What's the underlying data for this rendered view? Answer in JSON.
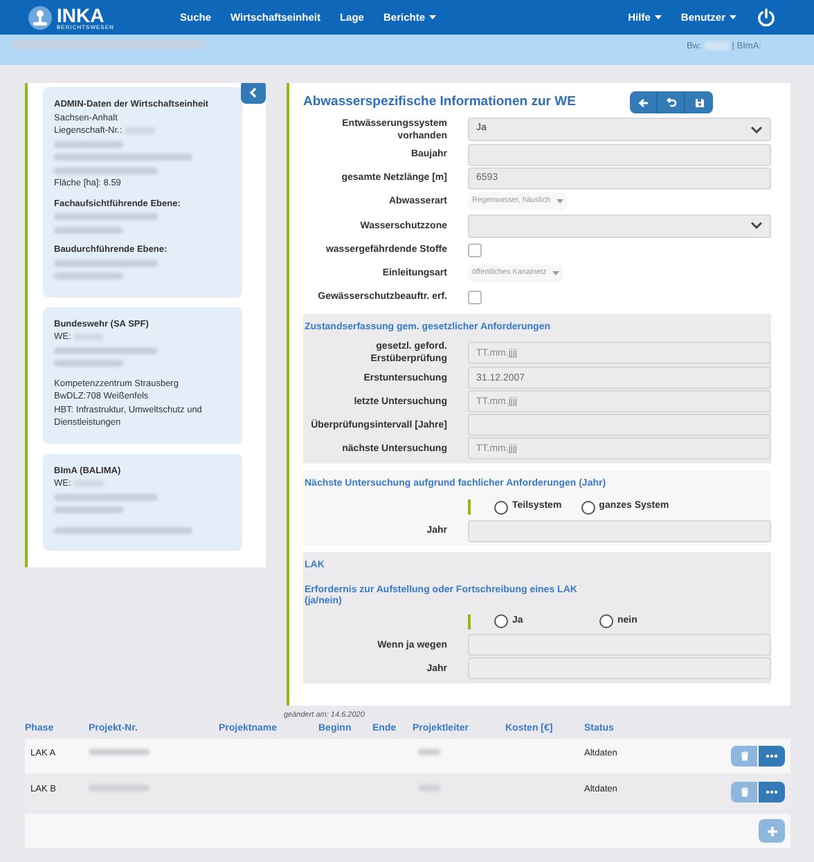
{
  "header": {
    "logo": {
      "name": "INKA",
      "subtitle": "BERICHTSWESEN"
    },
    "nav": [
      {
        "label": "Suche",
        "dropdown": false
      },
      {
        "label": "Wirtschaftseinheit",
        "dropdown": false
      },
      {
        "label": "Lage",
        "dropdown": false
      },
      {
        "label": "Berichte",
        "dropdown": true
      }
    ],
    "right_nav": [
      {
        "label": "Hilfe",
        "dropdown": true
      },
      {
        "label": "Benutzer",
        "dropdown": true
      }
    ]
  },
  "subbar": {
    "bw_label": "Bw:",
    "bima_label": "| BImA:"
  },
  "sidebar": {
    "cards": [
      {
        "title": "ADMIN-Daten der Wirtschaftseinheit",
        "groups": [
          {
            "lines": [
              {
                "kind": "text",
                "text": "Sachsen-Anhalt"
              },
              {
                "kind": "text_redacted",
                "text": "Liegenschaft-Nr.:"
              },
              {
                "kind": "redacted"
              },
              {
                "kind": "redacted"
              },
              {
                "kind": "redacted"
              },
              {
                "kind": "text",
                "text": "Fläche [ha]: 8.59"
              }
            ]
          },
          {
            "lines": [
              {
                "kind": "heading",
                "text": "Fachaufsichtführende Ebene:"
              },
              {
                "kind": "redacted"
              },
              {
                "kind": "redacted"
              }
            ]
          },
          {
            "lines": [
              {
                "kind": "heading",
                "text": "Baudurchführende Ebene:"
              },
              {
                "kind": "redacted"
              },
              {
                "kind": "redacted"
              }
            ]
          }
        ]
      },
      {
        "title": "Bundeswehr (SA SPF)",
        "groups": [
          {
            "lines": [
              {
                "kind": "text_redacted",
                "text": "WE:"
              },
              {
                "kind": "redacted"
              },
              {
                "kind": "redacted"
              }
            ]
          },
          {
            "lines": [
              {
                "kind": "text",
                "text": "Kompetenzzentrum Strausberg"
              },
              {
                "kind": "text",
                "text": "BwDLZ:708 Weißenfels"
              },
              {
                "kind": "text",
                "text": "HBT: Infrastruktur, Umweltschutz und Dienstleistungen"
              }
            ]
          }
        ]
      },
      {
        "title": "BImA (BALIMA)",
        "groups": [
          {
            "lines": [
              {
                "kind": "text_redacted",
                "text": "WE:"
              },
              {
                "kind": "redacted"
              },
              {
                "kind": "redacted"
              }
            ]
          },
          {
            "lines": [
              {
                "kind": "redacted"
              }
            ]
          }
        ]
      }
    ]
  },
  "main": {
    "title": "Abwasserspezifische Informationen zur WE",
    "fields": [
      {
        "label": "Entwässerungssystem vorhanden",
        "kind": "select",
        "value": "Ja"
      },
      {
        "label": "Baujahr",
        "kind": "input"
      },
      {
        "label": "gesamte Netzlänge [m]",
        "kind": "input",
        "value": "6593"
      },
      {
        "label": "Abwasserart",
        "kind": "multiselect",
        "value": "Regenwasser, häuslich"
      },
      {
        "label": "Wasserschutzzone",
        "kind": "select"
      },
      {
        "label": "wassergefährdende Stoffe",
        "kind": "checkbox",
        "checked": false
      },
      {
        "label": "Einleitungsart",
        "kind": "multiselect",
        "value": "öffentliches Kanalnetz"
      },
      {
        "label": "Gewässerschutzbeauftr. erf.",
        "kind": "checkbox",
        "checked": false
      }
    ],
    "sections": [
      {
        "title": "Zustandserfassung gem. gesetzlicher Anforderungen",
        "shaded": true,
        "fields": [
          {
            "label": "gesetzl. geford. Erstüberprüfung",
            "kind": "input",
            "placeholder": "TT.mm.jjjj"
          },
          {
            "label": "Erstuntersuchung",
            "kind": "input",
            "value": "31.12.2007"
          },
          {
            "label": "letzte Untersuchung",
            "kind": "input",
            "placeholder": "TT.mm.jjjj"
          },
          {
            "label": "Überprüfungsintervall [Jahre]",
            "kind": "input"
          },
          {
            "label": "nächste Untersuchung",
            "kind": "input",
            "placeholder": "TT.mm.jjjj"
          }
        ]
      },
      {
        "title": "Nächste Untersuchung aufgrund fachlicher Anforderungen (Jahr)",
        "shaded": false,
        "fields": [
          {
            "kind": "radio",
            "options": [
              {
                "label": "Teilsystem",
                "selected": false
              },
              {
                "label": "ganzes System",
                "selected": false
              }
            ]
          },
          {
            "label": "Jahr",
            "kind": "input"
          }
        ]
      },
      {
        "title": "LAK",
        "subtitle": "Erfordernis zur Aufstellung oder Fortschreibung eines LAK (ja/nein)",
        "shaded": true,
        "fields": [
          {
            "kind": "radio",
            "options": [
              {
                "label": "Ja",
                "selected": false
              },
              {
                "label": "nein",
                "selected": false
              }
            ]
          },
          {
            "label": "Wenn ja wegen",
            "kind": "input"
          },
          {
            "label": "Jahr",
            "kind": "input"
          }
        ]
      }
    ],
    "changed": "geändert am: 14.6.2020"
  },
  "table": {
    "columns": [
      "Phase",
      "Projekt-Nr.",
      "Projektname",
      "Beginn",
      "Ende",
      "Projektleiter",
      "Kosten [€]",
      "Status"
    ],
    "rows": [
      {
        "phase": "LAK A",
        "status": "Altdaten"
      },
      {
        "phase": "LAK B",
        "status": "Altdaten"
      }
    ]
  }
}
